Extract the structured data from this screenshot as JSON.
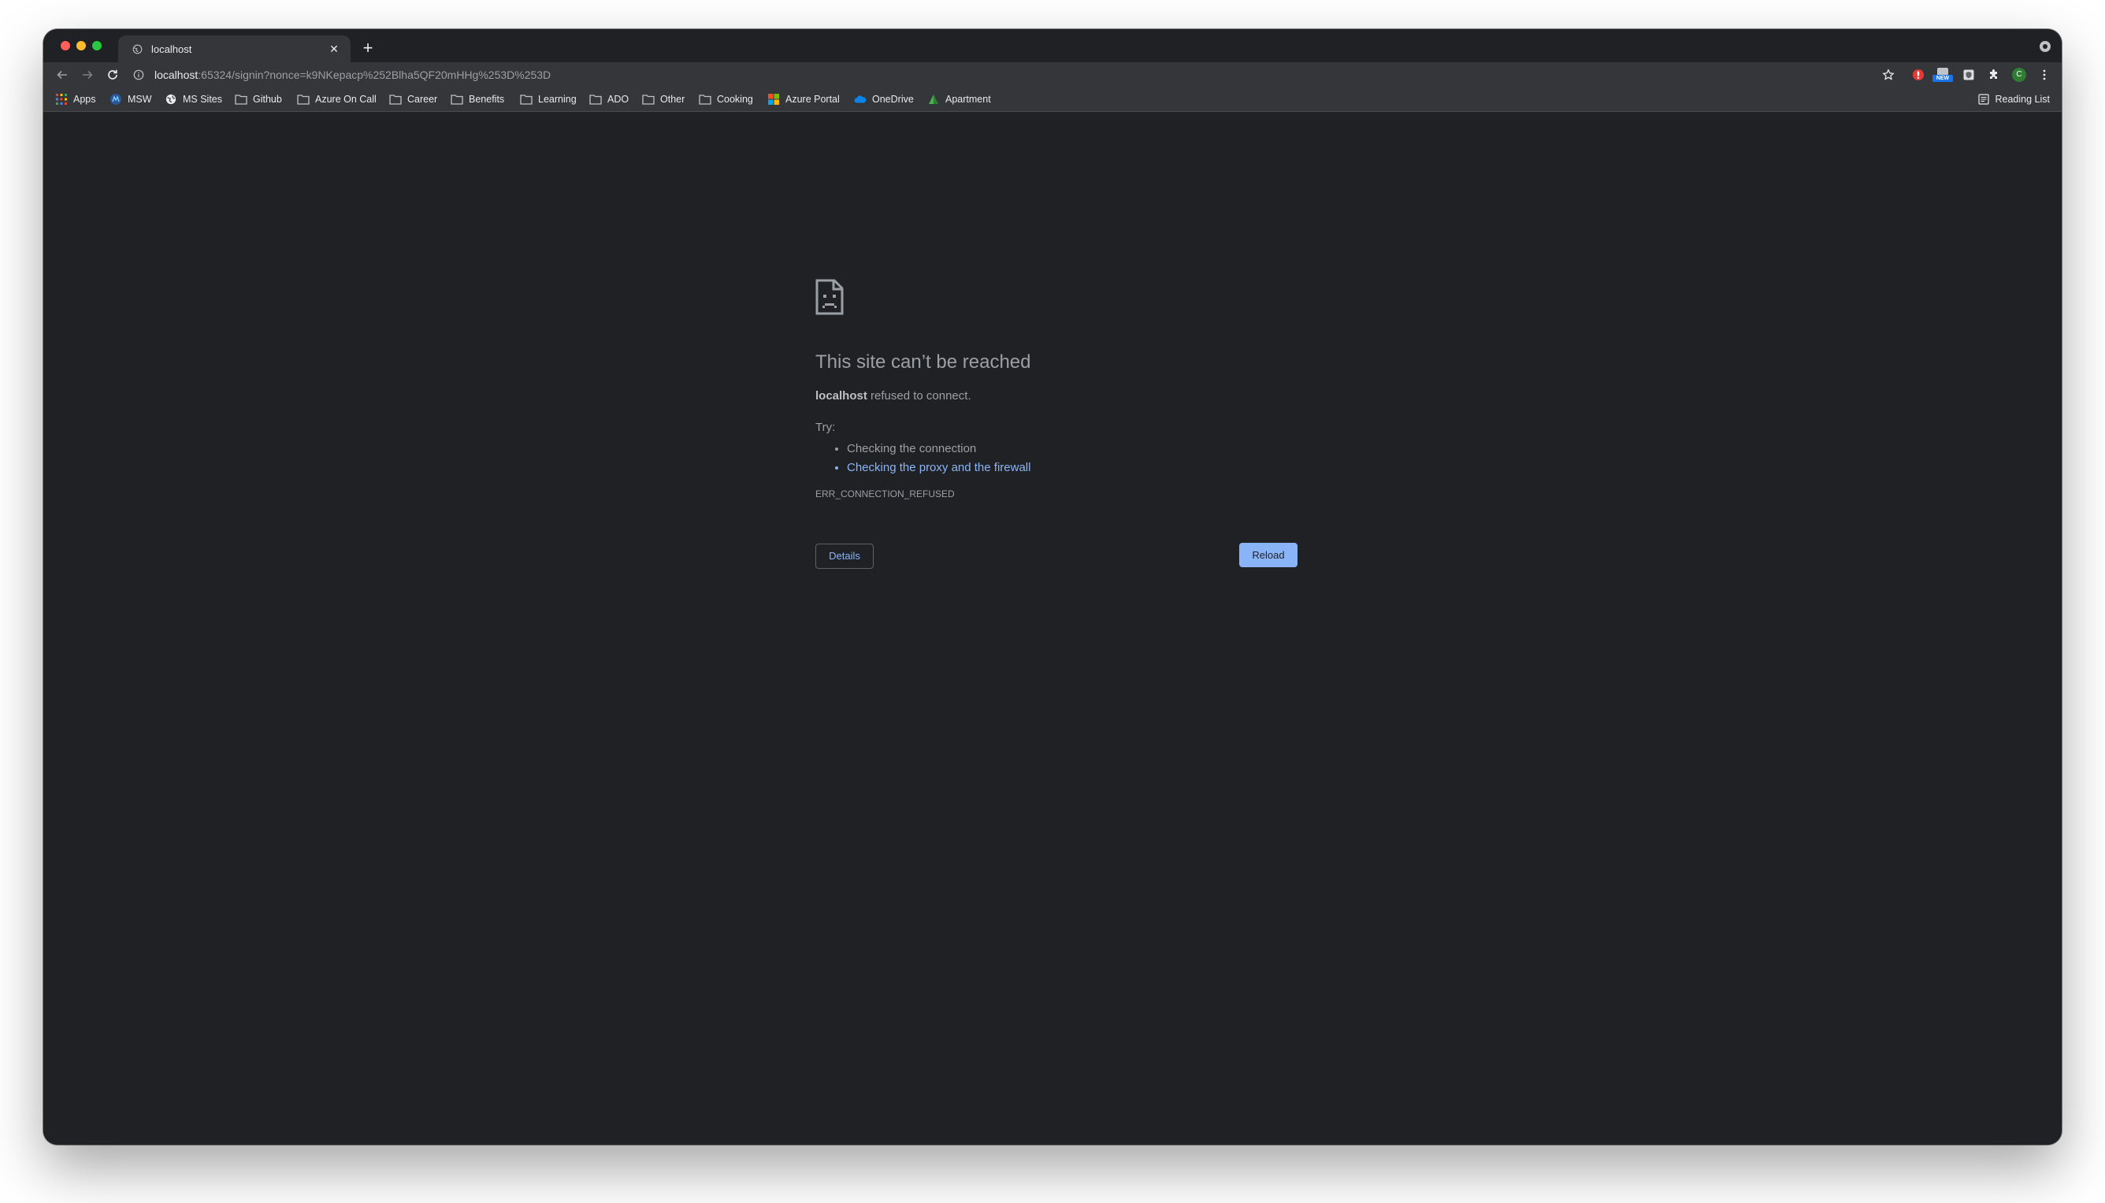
{
  "tab": {
    "title": "localhost",
    "close_glyph": "✕",
    "new_tab_glyph": "+"
  },
  "toolbar": {
    "url_host": "localhost",
    "url_rest": ":65324/signin?nonce=k9NKepacp%252Blha5QF20mHHg%253D%253D",
    "icons": [
      "back-icon",
      "forward-icon",
      "reload-icon",
      "info-icon",
      "star-icon",
      "extension-red-icon",
      "extension-new-icon",
      "extension-shield-icon",
      "puzzle-icon",
      "profile-avatar",
      "menu-icon"
    ],
    "new_badge": "NEW",
    "avatar_letter": "C"
  },
  "bookmarks": {
    "items": [
      {
        "label": "Apps",
        "icon": "apps-grid-icon"
      },
      {
        "label": "MSW",
        "icon": "msw-icon"
      },
      {
        "label": "MS Sites",
        "icon": "globe-icon"
      },
      {
        "label": "Github",
        "icon": "folder-icon"
      },
      {
        "label": "Azure On Call",
        "icon": "folder-icon"
      },
      {
        "label": "Career",
        "icon": "folder-icon"
      },
      {
        "label": "Benefits",
        "icon": "folder-icon"
      },
      {
        "label": "Learning",
        "icon": "folder-icon"
      },
      {
        "label": "ADO",
        "icon": "folder-icon"
      },
      {
        "label": "Other",
        "icon": "folder-icon"
      },
      {
        "label": "Cooking",
        "icon": "folder-icon"
      },
      {
        "label": "Azure Portal",
        "icon": "microsoft-logo-icon"
      },
      {
        "label": "OneDrive",
        "icon": "cloud-icon"
      },
      {
        "label": "Apartment",
        "icon": "apartment-icon"
      }
    ],
    "reading_list": "Reading List"
  },
  "error": {
    "title": "This site can’t be reached",
    "host": "localhost",
    "message": " refused to connect.",
    "try_label": "Try:",
    "suggestions": [
      "Checking the connection",
      "Checking the proxy and the firewall"
    ],
    "code": "ERR_CONNECTION_REFUSED",
    "details_button": "Details",
    "reload_button": "Reload"
  },
  "colors": {
    "background": "#202124",
    "toolbar": "#35363a",
    "link": "#8ab4f8",
    "text_muted": "#9aa0a6"
  }
}
